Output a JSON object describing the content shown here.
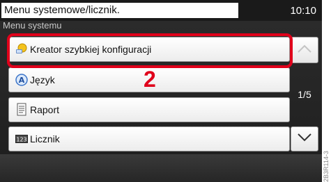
{
  "header": {
    "title": "Menu systemowe/licznik.",
    "time": "10:10",
    "subtitle": "Menu systemu"
  },
  "menu": {
    "items": [
      {
        "label": "Kreator szybkiej konfiguracji",
        "icon": "wizard-icon"
      },
      {
        "label": "Język",
        "icon": "language-icon"
      },
      {
        "label": "Raport",
        "icon": "report-icon"
      },
      {
        "label": "Licznik",
        "icon": "counter-icon"
      }
    ]
  },
  "pagination": {
    "page": "1/5"
  },
  "annotation": {
    "step": "2",
    "highlight_color": "#e0001b"
  },
  "side_code": "2B3R114-3"
}
